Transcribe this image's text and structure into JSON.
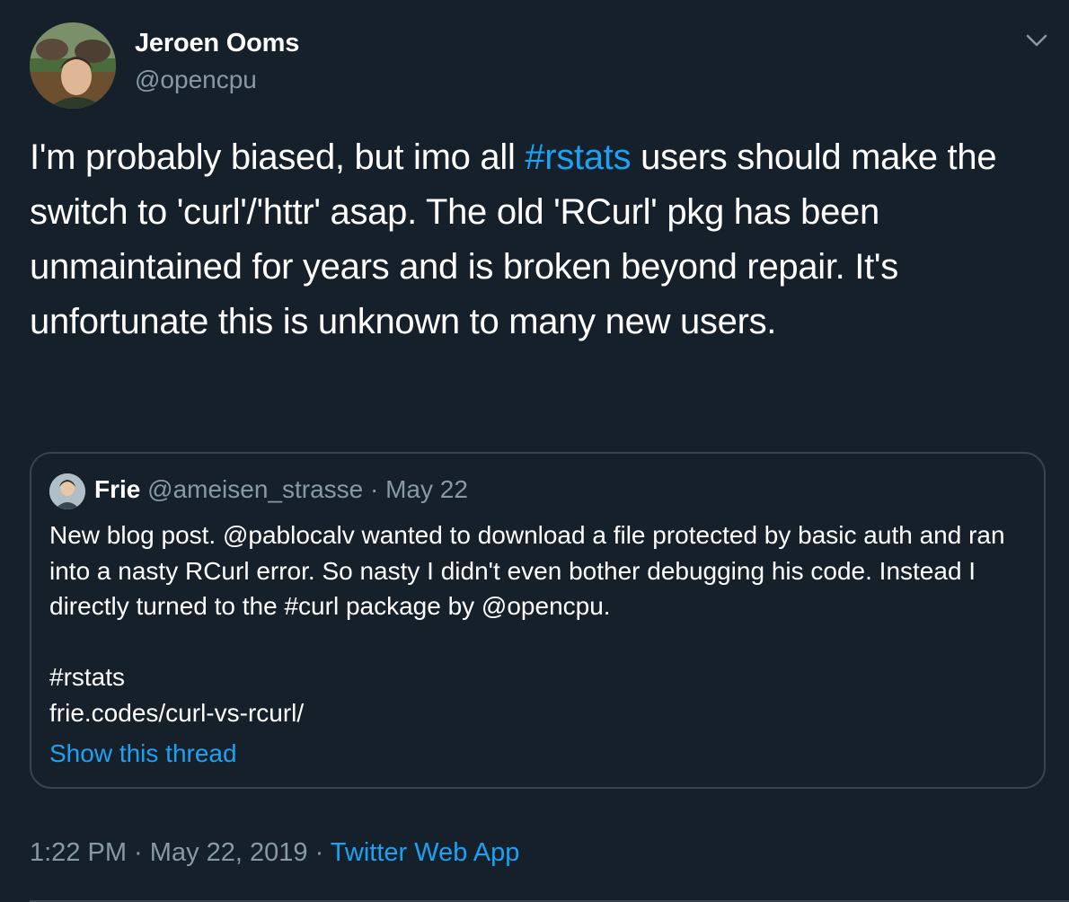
{
  "author": {
    "name": "Jeroen Ooms",
    "handle": "@opencpu"
  },
  "tweet": {
    "text_part1": "I'm probably biased, but imo all ",
    "hashtag": "#rstats",
    "text_part2": " users should make the switch to 'curl'/'httr' asap. The old 'RCurl' pkg has been unmaintained for years and is broken beyond repair. It's unfortunate this is unknown to many new users."
  },
  "quoted": {
    "name": "Frie",
    "handle": "@ameisen_strasse",
    "separator": " · ",
    "date": "May 22",
    "paragraph1": "New blog post. @pablocalv wanted to download a file protected by basic auth and ran into a nasty RCurl error. So nasty I didn't even bother debugging his code. Instead I directly turned to the #curl package by @opencpu.",
    "tag_line": "#rstats",
    "link_line": "frie.codes/curl-vs-rcurl/",
    "show_thread": "Show this thread"
  },
  "meta": {
    "time": "1:22 PM",
    "separator": " · ",
    "date": "May 22, 2019",
    "source": "Twitter Web App"
  },
  "colors": {
    "background": "#15202b",
    "text": "#ffffff",
    "secondary": "#8899a6",
    "accent": "#1da1f2",
    "border": "#38444d"
  },
  "icons": {
    "menu": "chevron-down-icon"
  }
}
